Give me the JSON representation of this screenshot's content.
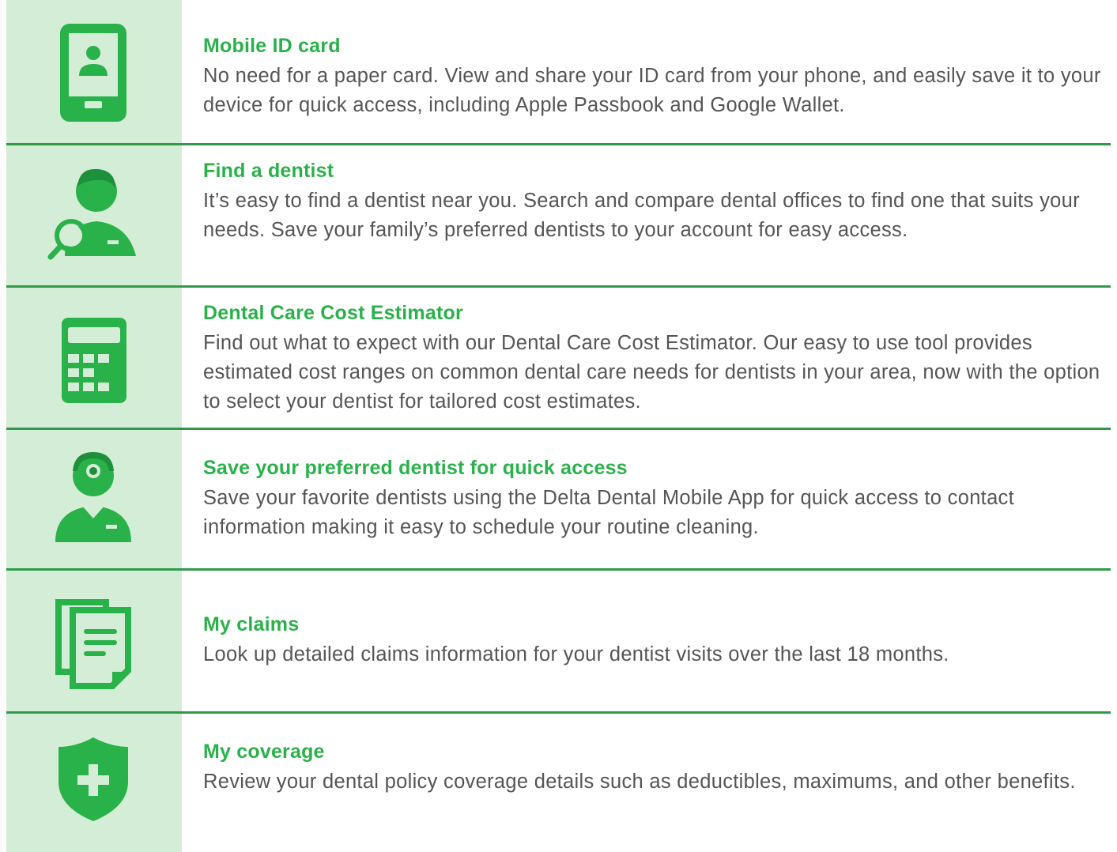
{
  "colors": {
    "accent": "#2ab24a",
    "icon_bg": "#d4edd6",
    "divider": "#2e9a4a",
    "text": "#555555"
  },
  "features": [
    {
      "icon": "mobile-id-card-icon",
      "title": "Mobile ID card",
      "desc": "No need for a paper card. View and share your ID card from your phone, and easily save it to your device for quick access, including Apple Passbook and Google Wallet."
    },
    {
      "icon": "find-dentist-icon",
      "title": "Find a dentist",
      "desc": "It’s easy to find a dentist near you. Search and compare dental offices to find one that suits your needs. Save your family’s preferred dentists to your account for easy access."
    },
    {
      "icon": "calculator-icon",
      "title": "Dental Care Cost Estimator",
      "desc": "Find out what to expect with our Dental Care Cost Estimator. Our easy to use tool provides estimated cost ranges on common dental care needs for dentists in your area, now with the option to select your dentist for tailored cost estimates."
    },
    {
      "icon": "dentist-icon",
      "title": "Save your preferred dentist for quick access",
      "desc": "Save your favorite dentists using the Delta Dental Mobile App for quick access to contact information making it easy to schedule your routine cleaning."
    },
    {
      "icon": "claims-documents-icon",
      "title": "My claims",
      "desc": "Look up detailed claims information for your dentist visits over the last 18 months."
    },
    {
      "icon": "coverage-shield-icon",
      "title": "My coverage",
      "desc": "Review your dental policy coverage details such as deductibles, maximums, and other benefits."
    }
  ]
}
